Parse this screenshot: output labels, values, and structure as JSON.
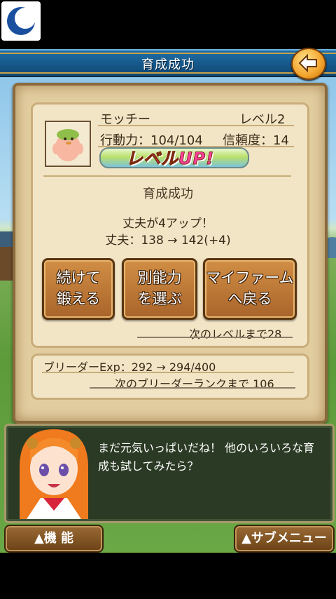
{
  "title_bar": {
    "title": "育成成功"
  },
  "monster": {
    "name": "モッチー",
    "level": "レベル2",
    "action_power": "行動力：104/104",
    "trust": "信頼度：14",
    "level_up": "レベルUP!"
  },
  "result": {
    "title": "育成成功",
    "stat_up": "丈夫が4アップ！",
    "stat_change": "丈夫：138 → 142(+4)"
  },
  "choices": [
    {
      "line1": "続けて",
      "line2": "鍛える"
    },
    {
      "line1": "別能力",
      "line2": "を選ぶ"
    },
    {
      "line1": "マイファーム",
      "line2": "へ戻る"
    }
  ],
  "next_level": "次のレベルまで28",
  "breeder": {
    "exp": "ブリーダーExp：292 → 294/400",
    "next_rank": "次のブリーダーランクまで 106"
  },
  "dialog": {
    "text": "まだ元気いっぱいだね！ 他のいろいろな育成も試してみたら？"
  },
  "bottom_bar": {
    "function": "▲機 能",
    "submenu": "▲サブメニュー"
  },
  "colors": {
    "title_bar": "#175a8c",
    "parchment": "#e2cda0",
    "button": "#b46e30",
    "dialog_bg": "#2b3a24"
  },
  "icons": {
    "back": "back-arrow-icon",
    "app_logo": "moon-logo-icon"
  }
}
